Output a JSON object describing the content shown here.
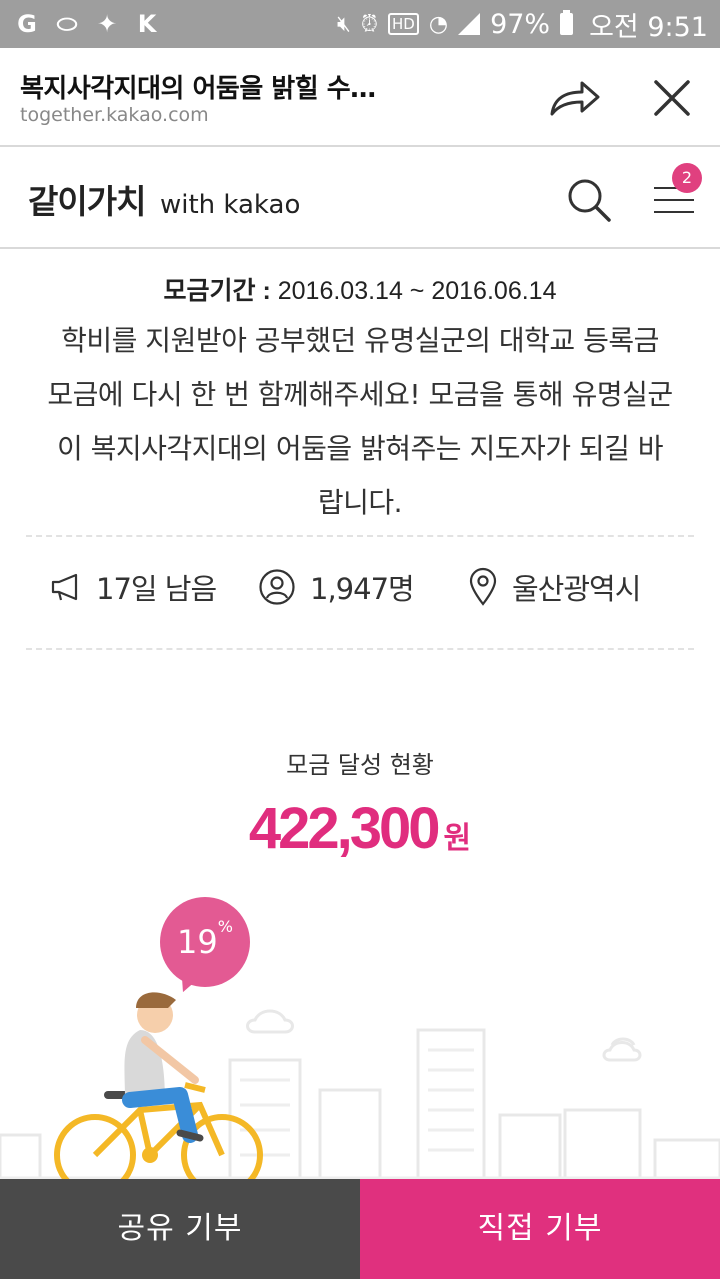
{
  "status_bar": {
    "battery": "97%",
    "time": "오전 9:51",
    "icons": [
      "g-icon",
      "pill-icon",
      "twitter-icon",
      "k-icon",
      "mute-icon",
      "alarm-icon",
      "hd-icon",
      "wifi-icon",
      "signal-icon",
      "battery-icon"
    ]
  },
  "browser": {
    "title": "복지사각지대의 어둠을 밝힐 수…",
    "url": "together.kakao.com"
  },
  "site": {
    "logo_main": "같이가치",
    "logo_sub": "with kakao",
    "menu_badge": "2"
  },
  "campaign": {
    "period_label": "모금기간 :",
    "period_value": "2016.03.14 ~ 2016.06.14",
    "description_lines": [
      "학비를 지원받아 공부했던 유명실군의 대학교 등록금",
      "모금에 다시 한 번 함께해주세요! 모금을 통해 유명실군",
      "이 복지사각지대의 어둠을 밝혀주는 지도자가 되길 바",
      "랍니다."
    ],
    "days_left": "17일 남음",
    "participants": "1,947명",
    "location": "울산광역시"
  },
  "goal": {
    "label": "모금 달성 현황",
    "amount": "422,300",
    "unit": "원",
    "percent": "19",
    "percent_sign": "%",
    "progress_fraction": 0.19
  },
  "buttons": {
    "share_label": "공유 기부",
    "donate_label": "직접 기부"
  },
  "colors": {
    "accent": "#e0307e",
    "status_bar": "#9e9e9e",
    "share_button": "#4a4a4a"
  }
}
